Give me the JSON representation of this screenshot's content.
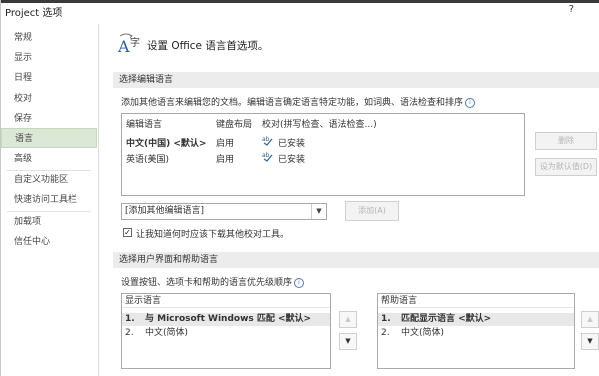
{
  "window": {
    "title": "Project 选项",
    "help": "?"
  },
  "sidebar": {
    "items": [
      {
        "label": "常规"
      },
      {
        "label": "显示"
      },
      {
        "label": "日程"
      },
      {
        "label": "校对"
      },
      {
        "label": "保存"
      },
      {
        "label": "语言",
        "active": true
      },
      {
        "label": "高级"
      },
      {
        "label": "自定义功能区"
      },
      {
        "label": "快速访问工具栏"
      },
      {
        "label": "加载项"
      },
      {
        "label": "信任中心"
      }
    ]
  },
  "header": {
    "icon": "language-icon",
    "text": "设置 Office 语言首选项。"
  },
  "editing": {
    "section_title": "选择编辑语言",
    "description": "添加其他语言来编辑您的文档。编辑语言确定语言特定功能，如词典、语法检查和排序",
    "columns": [
      "编辑语言",
      "键盘布局",
      "校对(拼写检查、语法检查...)"
    ],
    "rows": [
      {
        "language": "中文(中国) <默认>",
        "keyboard": "启用",
        "proofing": "已安装"
      },
      {
        "language": "英语(美国)",
        "keyboard": "启用",
        "proofing": "已安装"
      }
    ],
    "remove_button": "删除",
    "default_button": "设为默认值(D)",
    "add_select": "[添加其他编辑语言]",
    "add_button": "添加(A)",
    "notify_checkbox": {
      "label": "让我知道何时应该下载其他校对工具。",
      "checked": true
    }
  },
  "ui_lang": {
    "section_title": "选择用户界面和帮助语言",
    "description": "设置按钮、选项卡和帮助的语言优先级顺序",
    "display": {
      "header": "显示语言",
      "items": [
        {
          "num": "1.",
          "label": "与 Microsoft Windows 匹配 <默认>",
          "selected": true
        },
        {
          "num": "2.",
          "label": "中文(简体)"
        }
      ]
    },
    "help": {
      "header": "帮助语言",
      "items": [
        {
          "num": "1.",
          "label": "匹配显示语言 <默认>",
          "selected": true
        },
        {
          "num": "2.",
          "label": "中文(简体)"
        }
      ]
    },
    "up_glyph": "▲",
    "down_glyph": "▼"
  },
  "glyphs": {
    "check": "✓",
    "dropdown": "▼",
    "info": "i"
  }
}
